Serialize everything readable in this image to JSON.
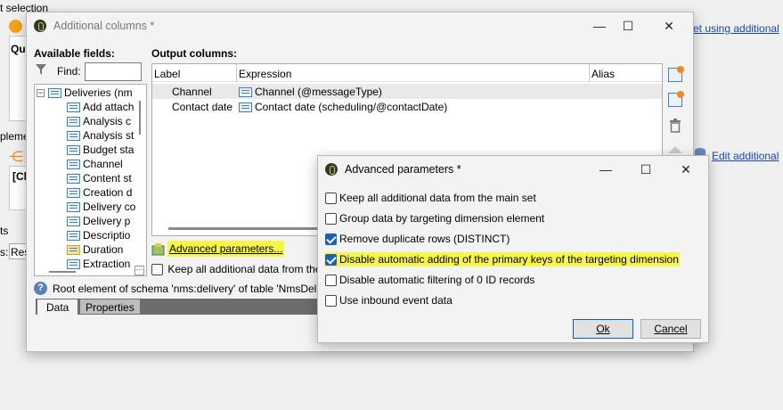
{
  "background": {
    "header_text": "t selection",
    "link1": "et using additional",
    "text_qu": "Qu",
    "text_ple": "pleme",
    "text_ci": "[Cl",
    "link2": "Edit additional",
    "text_ts": "ts",
    "text_s": "s:",
    "text_res": "Res"
  },
  "additional_columns": {
    "title": "Additional columns *",
    "available_fields_label": "Available fields:",
    "find_label": "Find:",
    "find_value": "",
    "output_columns_label": "Output columns:",
    "tree": {
      "root": "Deliveries (nm",
      "items": [
        "Add attach",
        "Analysis c",
        "Analysis st",
        "Budget sta",
        "Channel",
        "Content st",
        "Creation d",
        "Delivery co",
        "Delivery p",
        "Descriptio",
        "Duration",
        "Extraction"
      ]
    },
    "table": {
      "headers": [
        "Label",
        "Expression",
        "Alias"
      ],
      "rows": [
        {
          "label": "Channel",
          "expression": "Channel (@messageType)",
          "alias": ""
        },
        {
          "label": "Contact date",
          "expression": "Contact date (scheduling/@contactDate)",
          "alias": ""
        }
      ]
    },
    "advanced_link": "Advanced parameters...",
    "keep_all_label": "Keep all additional data from the",
    "status_text": "Root element of schema 'nms:delivery' of table 'NmsDel",
    "tabs": [
      "Data",
      "Properties"
    ]
  },
  "advanced_parameters": {
    "title": "Advanced parameters *",
    "options": [
      {
        "label": "Keep all additional data from the main set",
        "checked": false
      },
      {
        "label": "Group data by targeting dimension element",
        "checked": false
      },
      {
        "label": "Remove duplicate rows (DISTINCT)",
        "checked": true
      },
      {
        "label": "Disable automatic adding of the primary keys of the targeting dimension",
        "checked": true
      },
      {
        "label": "Disable automatic filtering of 0 ID records",
        "checked": false
      },
      {
        "label": "Use inbound event data",
        "checked": false
      }
    ],
    "ok_label": "Ok",
    "cancel_label": "Cancel"
  },
  "colors": {
    "highlight": "#f6f54a",
    "checkbox_checked": "#1c5fb8",
    "link": "#1a44b8"
  }
}
